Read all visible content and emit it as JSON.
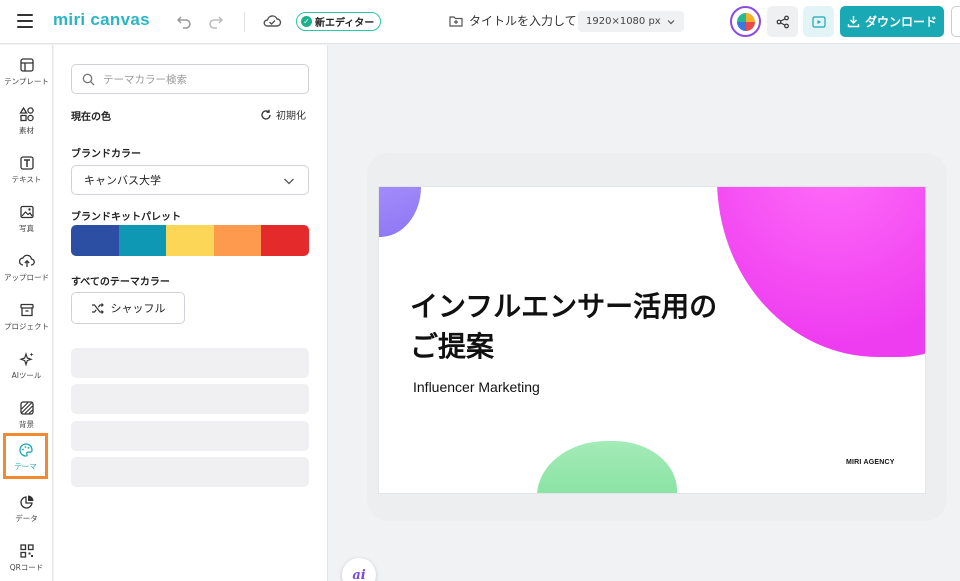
{
  "header": {
    "logo": "miri canvas",
    "new_editor_badge": "新エディター",
    "doc_title": "タイトルを入力して…",
    "canvas_size": "1920×1080 px",
    "download_label": "ダウンロード"
  },
  "rail": {
    "items": [
      {
        "label": "テンプレート",
        "icon": "template-icon"
      },
      {
        "label": "素材",
        "icon": "elements-icon"
      },
      {
        "label": "テキスト",
        "icon": "text-icon"
      },
      {
        "label": "写真",
        "icon": "photo-icon"
      },
      {
        "label": "アップロード",
        "icon": "upload-icon"
      },
      {
        "label": "プロジェクト",
        "icon": "project-icon"
      },
      {
        "label": "AIツール",
        "icon": "ai-tools-icon"
      },
      {
        "label": "背景",
        "icon": "background-icon"
      },
      {
        "label": "テーマ",
        "icon": "theme-icon",
        "active": true
      },
      {
        "label": "データ",
        "icon": "data-icon"
      },
      {
        "label": "QRコード",
        "icon": "qr-icon"
      }
    ]
  },
  "panel": {
    "search_placeholder": "テーマカラー検索",
    "current_color_label": "現在の色",
    "reset_label": "初期化",
    "brand_color_label": "ブランドカラー",
    "brand_selected": "キャンバス大学",
    "brand_kit_label": "ブランドキットパレット",
    "palette": [
      "#2c4fa3",
      "#0f98b3",
      "#fcd757",
      "#fe9a4d",
      "#e52a2c"
    ],
    "all_theme_label": "すべてのテーマカラー",
    "shuffle_label": "シャッフル"
  },
  "slide": {
    "title_line1": "インフルエンサー活用の",
    "title_line2": "ご提案",
    "subtitle": "Influencer Marketing",
    "agency": "MIRI AGENCY"
  },
  "ai_button": "ai"
}
